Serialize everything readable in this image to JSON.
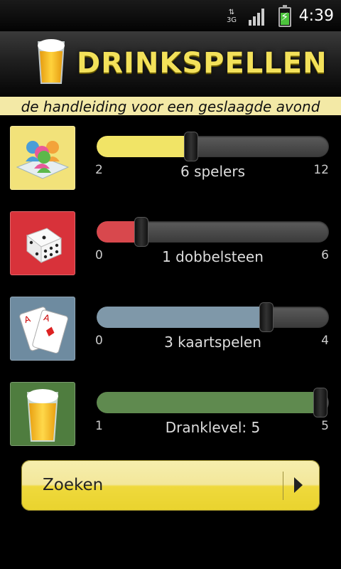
{
  "status_bar": {
    "time": "4:39",
    "network": "3G",
    "icons": [
      "network-3g-icon",
      "signal-icon",
      "battery-charging-icon"
    ]
  },
  "header": {
    "title": "DRINKSPELLEN",
    "subtitle": "de handleiding voor een geslaagde avond"
  },
  "sliders": [
    {
      "id": "players",
      "icon": "players-icon",
      "min": "2",
      "max": "12",
      "value": 6,
      "label": "6 spelers",
      "fill_color": "#f1e466",
      "tile_color": "#f2e27a"
    },
    {
      "id": "dice",
      "icon": "dice-icon",
      "min": "0",
      "max": "6",
      "value": 1,
      "label": "1 dobbelsteen",
      "fill_color": "#d8484d",
      "tile_color": "#d8323a"
    },
    {
      "id": "cards",
      "icon": "cards-icon",
      "min": "0",
      "max": "4",
      "value": 3,
      "label": "3 kaartspelen",
      "fill_color": "#7f98a9",
      "tile_color": "#6e8ba0"
    },
    {
      "id": "drinklevel",
      "icon": "beer-glass-icon",
      "min": "1",
      "max": "5",
      "value": 5,
      "label": "Dranklevel: 5",
      "fill_color": "#5f8a4f",
      "tile_color": "#4f7d3f"
    }
  ],
  "search": {
    "label": "Zoeken",
    "icon": "arrow-right-icon"
  }
}
